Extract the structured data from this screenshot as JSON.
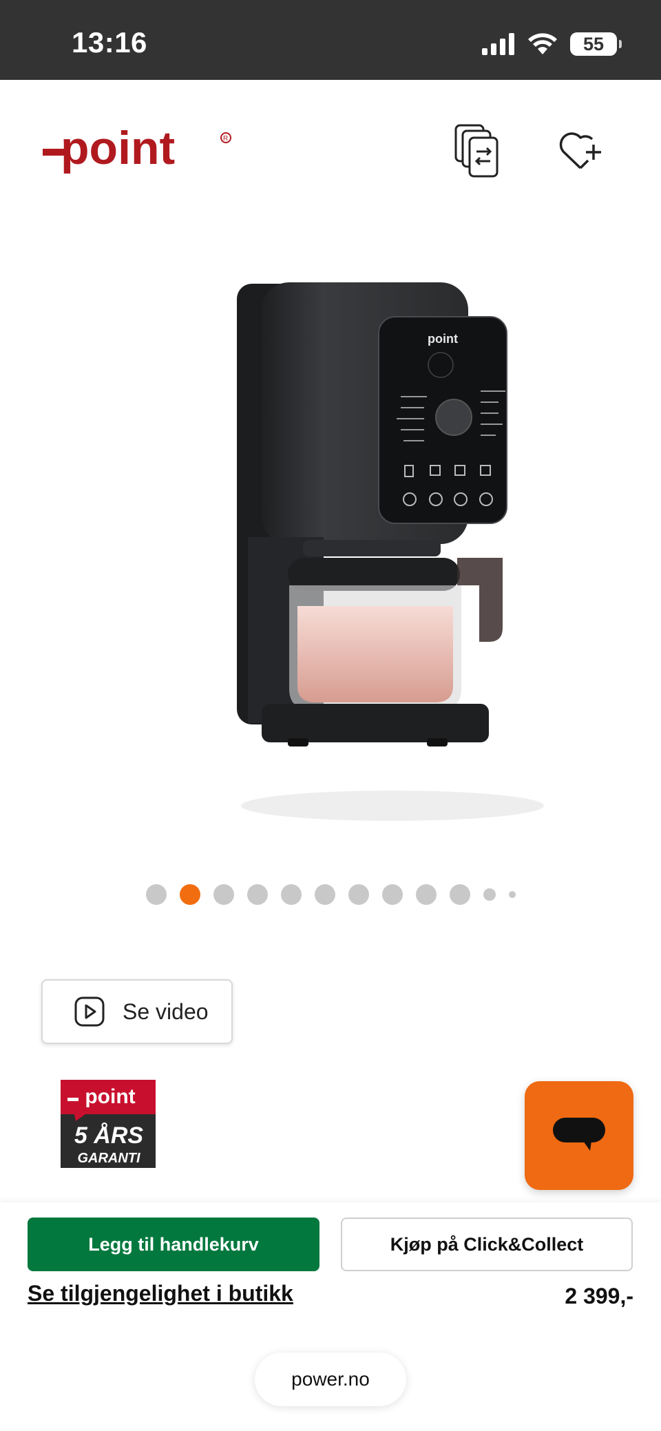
{
  "status_bar": {
    "time": "13:16",
    "battery": "55"
  },
  "brand": {
    "logo_text": "point",
    "logo_color": "#b01a1f"
  },
  "header": {
    "compare_icon": "compare-icon",
    "favorite_icon": "heart-plus-icon"
  },
  "product": {
    "image_alt": "point ice cream / slush maker",
    "device_brand": "point",
    "carousel": {
      "total": 12,
      "active_index": 1
    }
  },
  "video_button": {
    "label": "Se video",
    "icon": "play-icon"
  },
  "warranty_badge": {
    "brand": "point",
    "line1": "5 ÅRS",
    "line2": "GARANTI"
  },
  "chat": {
    "icon": "chat-bubble-icon",
    "color": "#ef6a12"
  },
  "actions": {
    "add_to_cart": "Legg til handlekurv",
    "click_collect": "Kjøp på Click&Collect",
    "availability_link": "Se tilgjengelighet i butikk",
    "price": "2 399,-",
    "primary_color": "#03783e"
  },
  "browser": {
    "url": "power.no"
  }
}
